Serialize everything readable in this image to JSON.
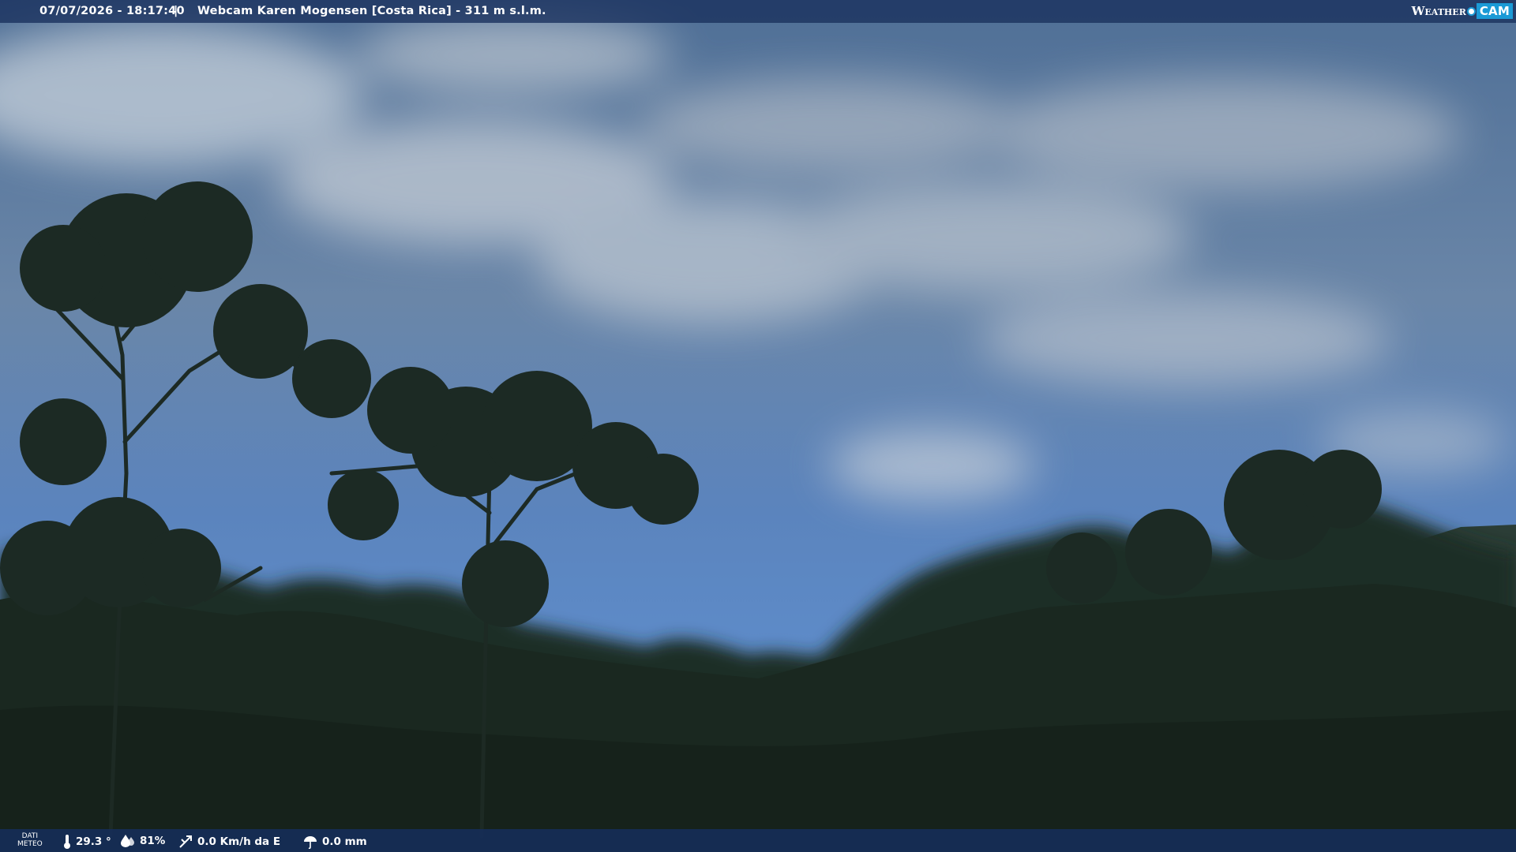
{
  "header": {
    "timestamp": "07/07/2026 - 18:17:40",
    "separator": "|",
    "title": "Webcam Karen Mogensen [Costa Rica]  - 311 m s.l.m."
  },
  "logo": {
    "text_weather": "Weather",
    "text_cam": "CAM"
  },
  "weather": {
    "label_line1": "DATI",
    "label_line2": "METEO",
    "temperature": "29.3 °",
    "humidity": "81%",
    "wind": "0.0 Km/h da E",
    "rain": "0.0 mm"
  },
  "colors": {
    "bar": "#18305c",
    "accent": "#1b9ad6"
  },
  "icons": [
    "thermometer-icon",
    "humidity-icon",
    "wind-icon",
    "rain-icon"
  ]
}
